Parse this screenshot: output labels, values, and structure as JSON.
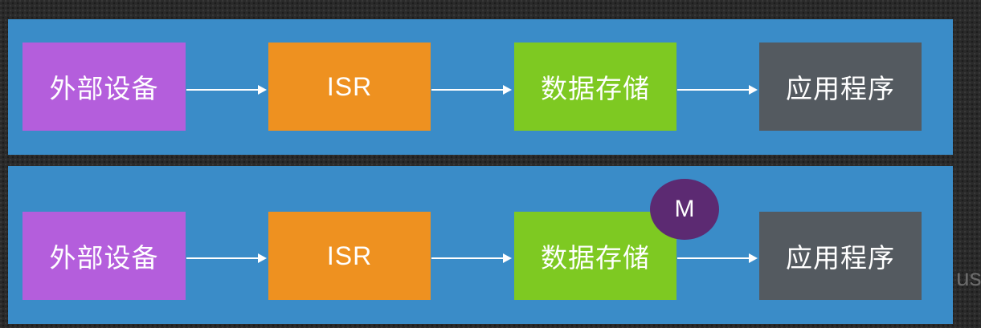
{
  "diagrams": [
    {
      "nodes": {
        "device": "外部设备",
        "isr": "ISR",
        "store": "数据存储",
        "app": "应用程序"
      }
    },
    {
      "nodes": {
        "device": "外部设备",
        "isr": "ISR",
        "store": "数据存储",
        "app": "应用程序"
      },
      "badge": "M"
    }
  ],
  "edge_text": "us",
  "colors": {
    "panel": "#3a8cc8",
    "device": "#b45edc",
    "isr": "#ee9120",
    "store": "#7ec922",
    "app": "#545a60",
    "badge": "#5c2a72"
  }
}
